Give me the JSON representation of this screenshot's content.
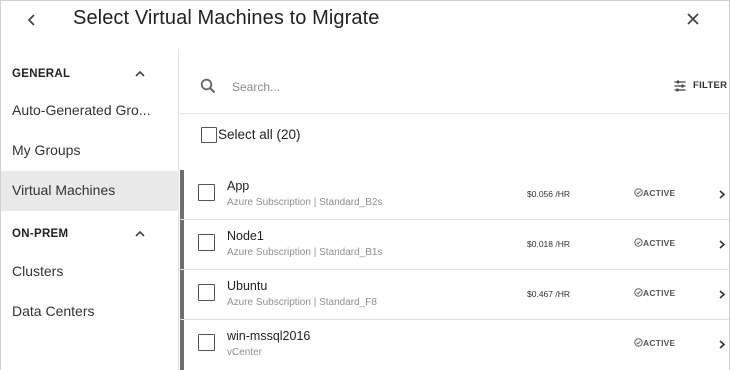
{
  "header": {
    "title": "Select Virtual Machines to Migrate"
  },
  "sidebar": {
    "sections": [
      {
        "label": "GENERAL",
        "items": [
          {
            "label": "Auto-Generated Gro..."
          },
          {
            "label": "My Groups"
          },
          {
            "label": "Virtual Machines",
            "selected": true
          }
        ]
      },
      {
        "label": "ON-PREM",
        "items": [
          {
            "label": "Clusters"
          },
          {
            "label": "Data Centers"
          }
        ]
      }
    ]
  },
  "main": {
    "search": {
      "placeholder": "Search...",
      "value": ""
    },
    "filter_label": "FILTER",
    "select_all_label": "Select all (20)",
    "rows": [
      {
        "name": "App",
        "subtitle": "Azure Subscription | Standard_B2s",
        "price": "$0.056 /HR",
        "status": "ACTIVE"
      },
      {
        "name": "Node1",
        "subtitle": "Azure Subscription | Standard_B1s",
        "price": "$0.018 /HR",
        "status": "ACTIVE"
      },
      {
        "name": "Ubuntu",
        "subtitle": "Azure Subscription | Standard_F8",
        "price": "$0.467 /HR",
        "status": "ACTIVE"
      },
      {
        "name": "win-mssql2016",
        "subtitle": "vCenter",
        "price": "",
        "status": "ACTIVE"
      }
    ]
  },
  "colors": {
    "selected_bg": "#e9e9e9",
    "row_accent": "#6e6e6e",
    "muted_text": "#8f8f8f"
  },
  "icons": {
    "back": "chevron-left-icon",
    "close": "close-icon",
    "collapse": "chevron-up-icon",
    "search": "search-icon",
    "filter": "filter-sliders-icon",
    "status": "check-circle-icon",
    "row_open": "chevron-right-icon"
  }
}
